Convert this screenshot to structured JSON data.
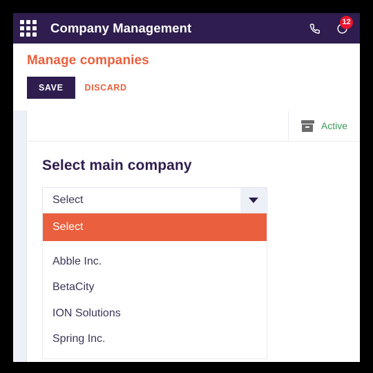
{
  "colors": {
    "header_bg": "#2e1d4e",
    "accent_orange": "#ea5f3d",
    "badge_red": "#e8142d",
    "active_green": "#3a9a55",
    "panel_bg": "#eef0f8"
  },
  "topbar": {
    "apps_icon": "apps-grid-icon",
    "title": "Company Management",
    "phone_icon": "phone-icon",
    "activity_icon": "activity-refresh-icon",
    "activity_badge_count": "12"
  },
  "page": {
    "title": "Manage companies",
    "save_label": "SAVE",
    "discard_label": "DISCARD"
  },
  "filter_bar": {
    "archive_icon": "archive-box-icon",
    "active_label": "Active"
  },
  "form": {
    "label": "Select main company",
    "select": {
      "value": "Select",
      "placeholder": "Select",
      "caret_icon": "chevron-down-icon",
      "expanded": true,
      "options": [
        {
          "label": "Select",
          "selected": true
        },
        {
          "label": "Abble Inc.",
          "selected": false
        },
        {
          "label": "BetaCity",
          "selected": false
        },
        {
          "label": "ION Solutions",
          "selected": false
        },
        {
          "label": "Spring Inc.",
          "selected": false
        }
      ]
    }
  }
}
